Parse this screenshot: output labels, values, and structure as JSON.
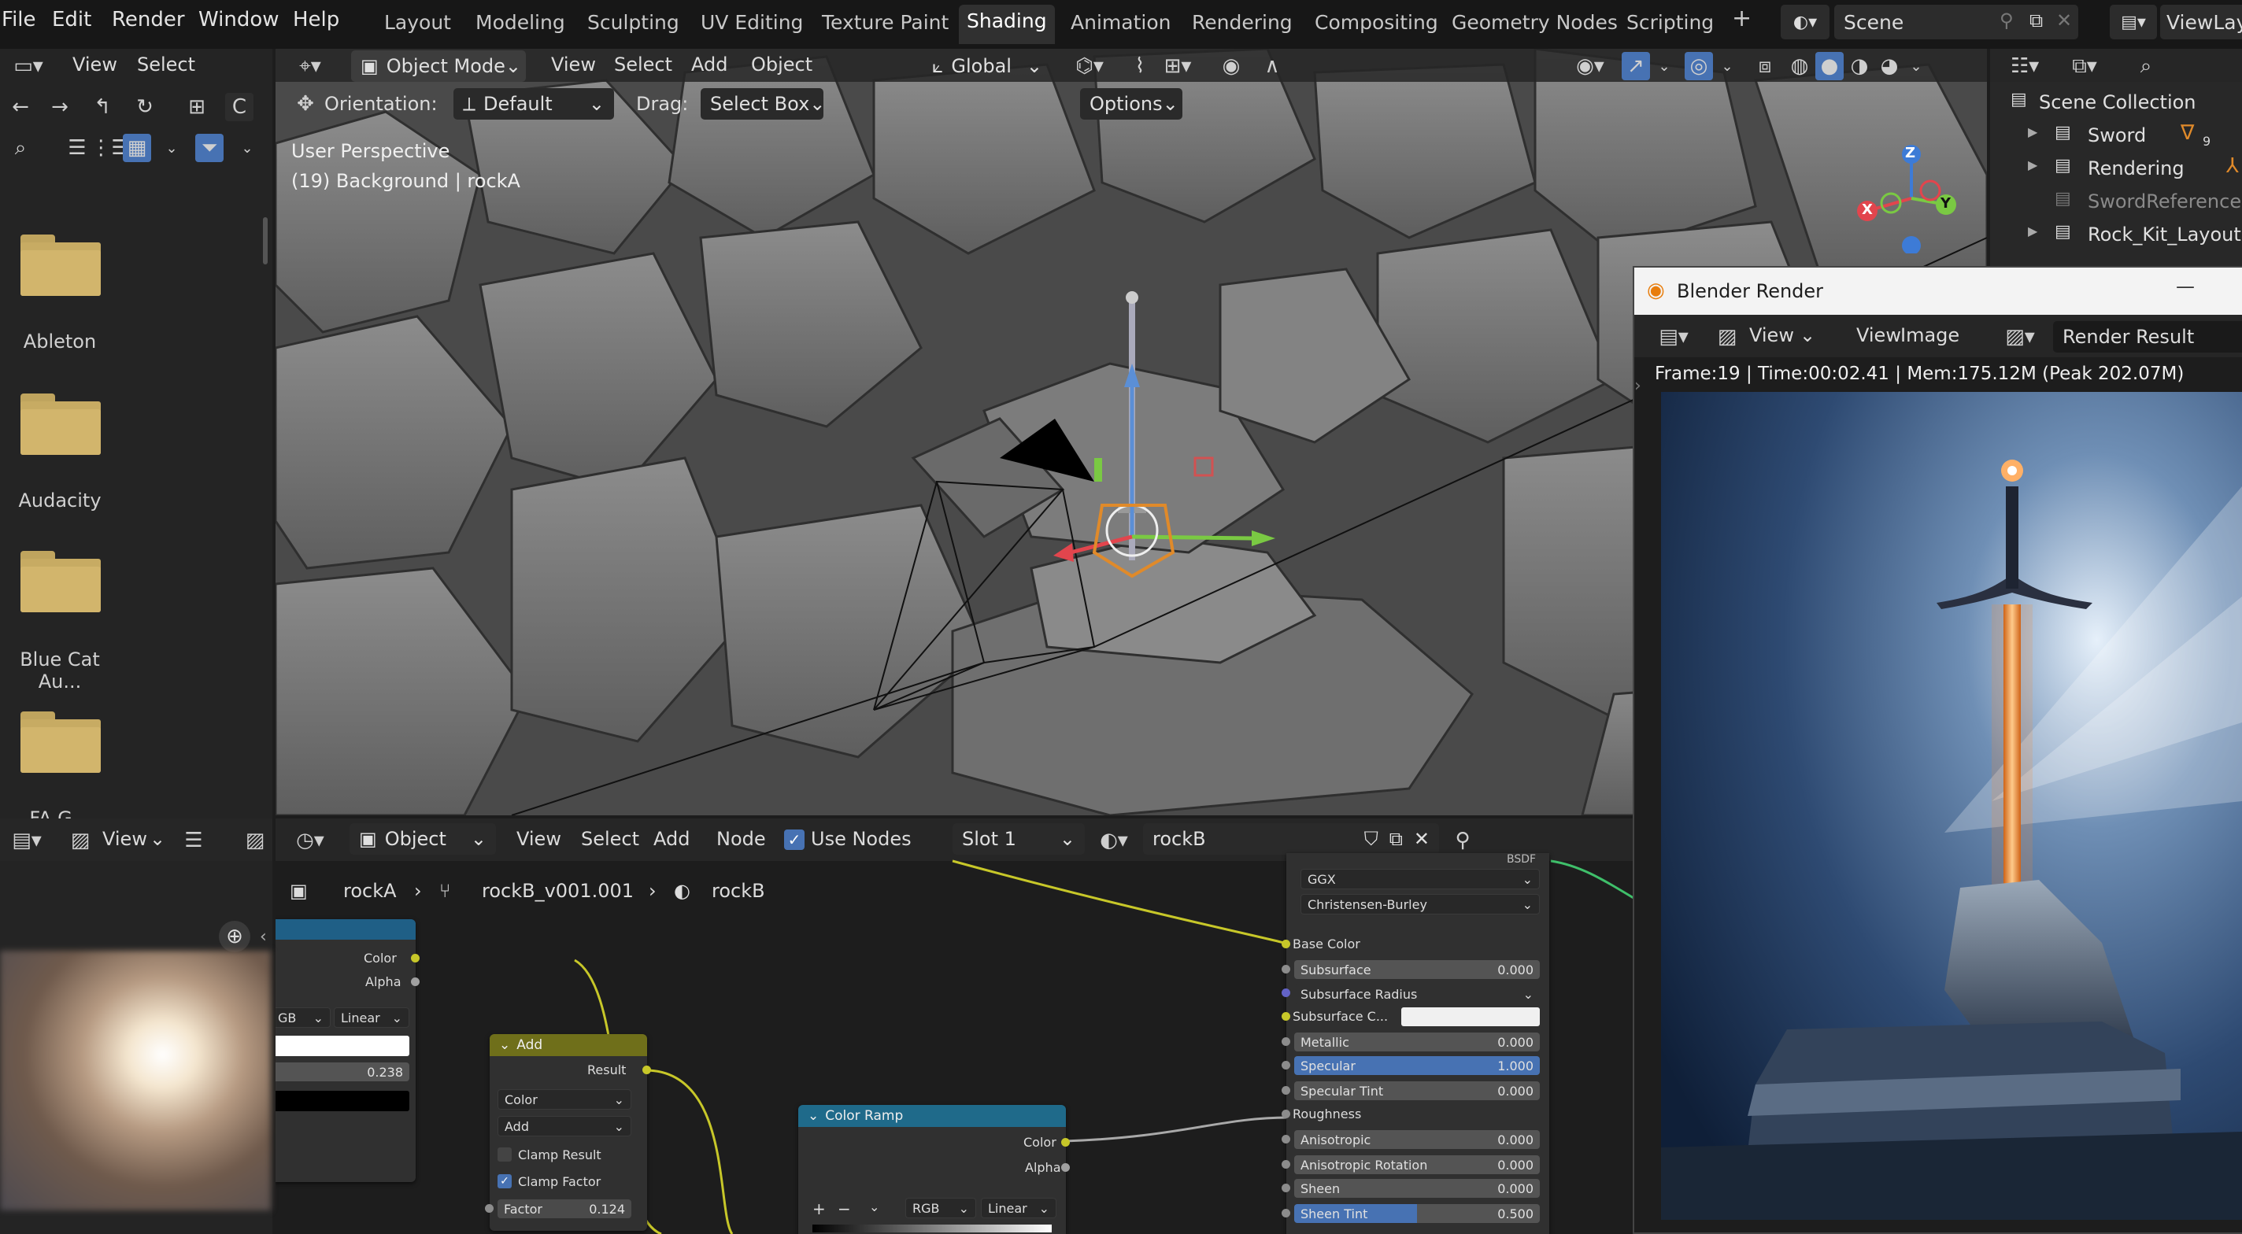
{
  "menubar": {
    "menus": [
      "File",
      "Edit",
      "Render",
      "Window",
      "Help"
    ],
    "workspaces": [
      "Layout",
      "Modeling",
      "Sculpting",
      "UV Editing",
      "Texture Paint",
      "Shading",
      "Animation",
      "Rendering",
      "Compositing",
      "Geometry Nodes",
      "Scripting"
    ],
    "active_workspace": "Shading",
    "add_tab": "+",
    "scene": "Scene",
    "view_layer": "ViewLaye"
  },
  "file_browser": {
    "header": {
      "view": "View",
      "select": "Select"
    },
    "path_toggle": "C",
    "folders": [
      "Ableton",
      "Audacity",
      "Blue Cat Au...",
      "FA G..."
    ]
  },
  "viewport": {
    "mode": "Object Mode",
    "menus": [
      "View",
      "Select",
      "Add",
      "Object"
    ],
    "transform_orientation": "Global",
    "orientation_label": "Orientation:",
    "orientation_value": "Default",
    "drag_label": "Drag:",
    "drag_value": "Select Box",
    "options": "Options",
    "overlay_line1": "User Perspective",
    "overlay_line2": "(19) Background | rockA",
    "gizmo": {
      "x": "X",
      "y": "Y",
      "z": "Z"
    }
  },
  "outliner": {
    "title": "Scene Collection",
    "items": [
      {
        "label": "Sword",
        "badge": "9",
        "dim": false
      },
      {
        "label": "Rendering",
        "badge": "",
        "dim": false
      },
      {
        "label": "SwordReference",
        "badge": "",
        "dim": true
      },
      {
        "label": "Rock_Kit_Layout",
        "badge": "",
        "dim": false
      }
    ]
  },
  "render_window": {
    "title": "Blender Render",
    "minimize": "—",
    "menus": [
      "View",
      "View",
      "Image"
    ],
    "slot": "Render Result",
    "stats": "Frame:19 | Time:00:02.41 | Mem:175.12M (Peak 202.07M)"
  },
  "image_preview": {
    "view": "View"
  },
  "node_editor": {
    "type": "Object",
    "menus": [
      "View",
      "Select",
      "Add",
      "Node"
    ],
    "use_nodes_label": "Use Nodes",
    "use_nodes": true,
    "slot": "Slot 1",
    "material": "rockB",
    "breadcrumb": [
      "rockA",
      "rockB_v001.001",
      "rockB"
    ]
  },
  "nodes": {
    "image_node": {
      "outputs": [
        "Color",
        "Alpha"
      ],
      "color_space": "GB",
      "interp": "Linear",
      "value": "0.238"
    },
    "add_node": {
      "title": "Add",
      "output": "Result",
      "data_type": "Color",
      "blend": "Add",
      "clamp_result": "Clamp Result",
      "clamp_factor": "Clamp Factor",
      "factor_label": "Factor",
      "factor_value": "0.124"
    },
    "color_ramp": {
      "title": "Color Ramp",
      "outputs": [
        "Color",
        "Alpha"
      ],
      "mode": "RGB",
      "interp": "Linear",
      "plus": "+",
      "minus": "−"
    },
    "principled": {
      "distribution": "GGX",
      "subsurface_method": "Christensen-Burley",
      "rows": [
        {
          "label": "Base Color",
          "value": "",
          "kind": "socket"
        },
        {
          "label": "Subsurface",
          "value": "0.000",
          "kind": "field"
        },
        {
          "label": "Subsurface Radius",
          "value": "",
          "kind": "drop"
        },
        {
          "label": "Subsurface C...",
          "value": "",
          "kind": "color"
        },
        {
          "label": "Metallic",
          "value": "0.000",
          "kind": "field"
        },
        {
          "label": "Specular",
          "value": "1.000",
          "kind": "blue"
        },
        {
          "label": "Specular Tint",
          "value": "0.000",
          "kind": "field"
        },
        {
          "label": "Roughness",
          "value": "",
          "kind": "socket"
        },
        {
          "label": "Anisotropic",
          "value": "0.000",
          "kind": "field"
        },
        {
          "label": "Anisotropic Rotation",
          "value": "0.000",
          "kind": "field"
        },
        {
          "label": "Sheen",
          "value": "0.000",
          "kind": "field"
        },
        {
          "label": "Sheen Tint",
          "value": "0.500",
          "kind": "half"
        }
      ],
      "bsdf_cut": "BSDF"
    }
  },
  "colors": {
    "accent": "#4772b3",
    "node_yellow_socket": "#c7c729",
    "add_header": "#6f6f1a",
    "ramp_header": "#1f6a8a",
    "image_header": "#1f5f86",
    "folder": "#c9ad66"
  }
}
